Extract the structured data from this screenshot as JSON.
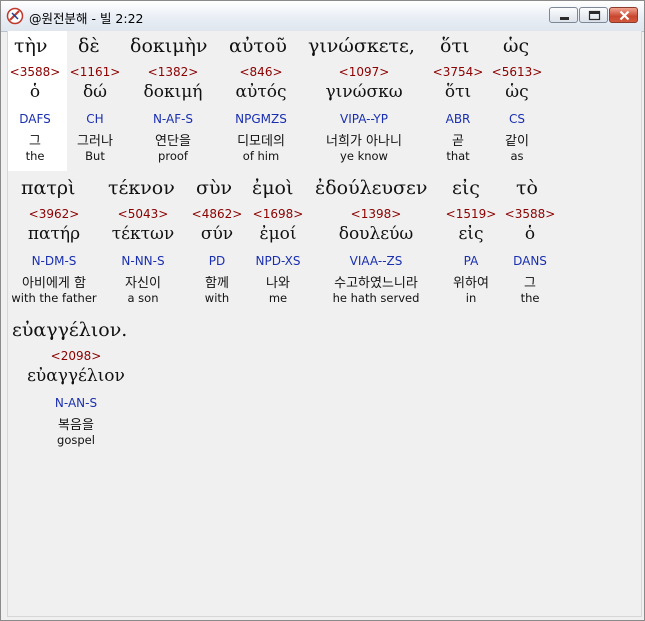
{
  "window": {
    "title": "@원전분해 - 빌 2:22",
    "buttons": {
      "minimize": "minimize",
      "maximize": "maximize",
      "close": "close"
    }
  },
  "interlinear": [
    {
      "greek": "τὴν",
      "strong": "<3588>",
      "lemma": "ὁ",
      "morph": "DAFS",
      "korean": "그",
      "english": "the"
    },
    {
      "greek": "δὲ",
      "strong": "<1161>",
      "lemma": "δώ",
      "morph": "CH",
      "korean": "그러나",
      "english": "But"
    },
    {
      "greek": "δοκιμὴν",
      "strong": "<1382>",
      "lemma": "δοκιμή",
      "morph": "N-AF-S",
      "korean": "연단을",
      "english": "proof"
    },
    {
      "greek": "αὐτοῦ",
      "strong": "<846>",
      "lemma": "αὐτός",
      "morph": "NPGMZS",
      "korean": "디모데의",
      "english": "of him"
    },
    {
      "greek": "γινώσκετε,",
      "strong": "<1097>",
      "lemma": "γινώσκω",
      "morph": "VIPA--YP",
      "korean": "너희가 아나니",
      "english": "ye know"
    },
    {
      "greek": "ὅτι",
      "strong": "<3754>",
      "lemma": "ὅτι",
      "morph": "ABR",
      "korean": "곧",
      "english": "that"
    },
    {
      "greek": "ὡς",
      "strong": "<5613>",
      "lemma": "ὡς",
      "morph": "CS",
      "korean": "같이",
      "english": "as"
    },
    {
      "greek": "πατρὶ",
      "strong": "<3962>",
      "lemma": "πατήρ",
      "morph": "N-DM-S",
      "korean": "아비에게 함",
      "english": "with the father"
    },
    {
      "greek": "τέκνον",
      "strong": "<5043>",
      "lemma": "τέκτων",
      "morph": "N-NN-S",
      "korean": "자신이",
      "english": "a son"
    },
    {
      "greek": "σὺν",
      "strong": "<4862>",
      "lemma": "σύν",
      "morph": "PD",
      "korean": "함께",
      "english": "with"
    },
    {
      "greek": "ἐμοὶ",
      "strong": "<1698>",
      "lemma": "ἐμοί",
      "morph": "NPD-XS",
      "korean": "나와",
      "english": "me"
    },
    {
      "greek": "ἐδούλευσεν",
      "strong": "<1398>",
      "lemma": "δουλεύω",
      "morph": "VIAA--ZS",
      "korean": "수고하였느니라",
      "english": "he hath served"
    },
    {
      "greek": "εἰς",
      "strong": "<1519>",
      "lemma": "εἰς",
      "morph": "PA",
      "korean": "위하여",
      "english": "in"
    },
    {
      "greek": "τὸ",
      "strong": "<3588>",
      "lemma": "ὁ",
      "morph": "DANS",
      "korean": "그",
      "english": "the"
    },
    {
      "greek": "εὐαγγέλιον.",
      "strong": "<2098>",
      "lemma": "εὐαγγέλιον",
      "morph": "N-AN-S",
      "korean": "복음을",
      "english": "gospel"
    }
  ],
  "colors": {
    "strong": "#8b0000",
    "morph": "#1a2fb0",
    "highlight": "#ffffff",
    "background": "#f0f0f0"
  }
}
